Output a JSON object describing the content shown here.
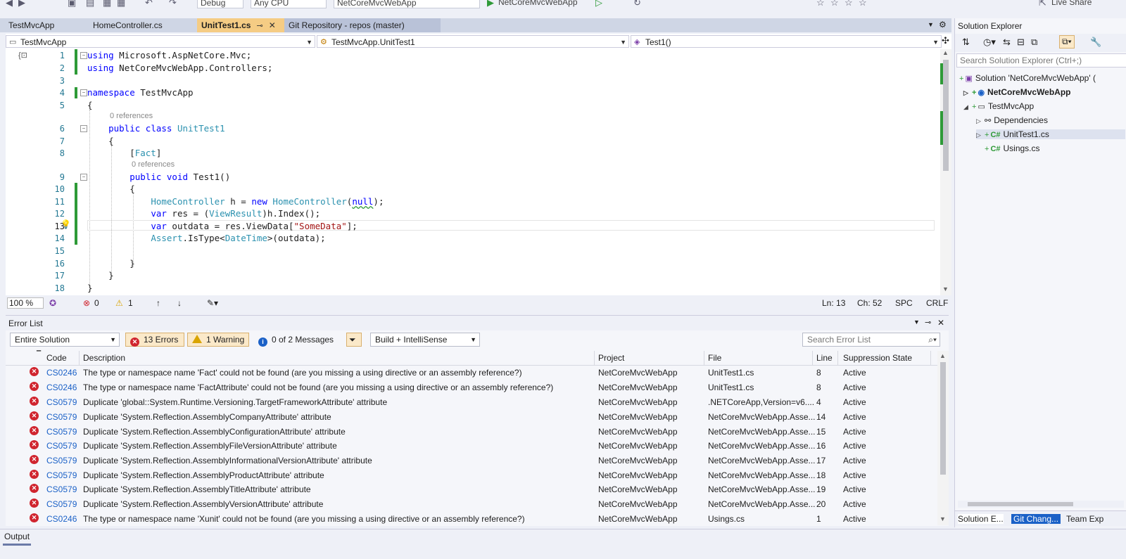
{
  "toolbar": {
    "config": "Debug",
    "platform": "Any CPU",
    "startup": "NetCoreMvcWebApp",
    "run_label": "NetCoreMvcWebApp",
    "live_share": "Live Share"
  },
  "tabs": [
    {
      "label": "TestMvcApp"
    },
    {
      "label": "HomeController.cs"
    },
    {
      "label": "UnitTest1.cs",
      "pin": "⊸",
      "close": "✕"
    },
    {
      "label": "Git Repository - repos (master)"
    }
  ],
  "nav": {
    "project": "TestMvcApp",
    "type": "TestMvcApp.UnitTest1",
    "member": "Test1()"
  },
  "code": {
    "lines": [
      "1",
      "2",
      "3",
      "4",
      "5",
      "6",
      "7",
      "8",
      "9",
      "10",
      "11",
      "12",
      "13",
      "14",
      "15",
      "16",
      "17",
      "18"
    ],
    "codelens_class": "0 references",
    "codelens_method": "0 references"
  },
  "editor_status": {
    "zoom": "100 %",
    "errors": "0",
    "warnings": "1",
    "ln": "Ln: 13",
    "ch": "Ch: 52",
    "spc": "SPC",
    "crlf": "CRLF"
  },
  "error_list": {
    "title": "Error List",
    "scope": "Entire Solution",
    "errors_btn": "13 Errors",
    "warnings_btn": "1 Warning",
    "messages_btn": "0 of 2 Messages",
    "source": "Build + IntelliSense",
    "search_placeholder": "Search Error List",
    "columns": {
      "code": "Code",
      "description": "Description",
      "project": "Project",
      "file": "File",
      "line": "Line",
      "suppression": "Suppression State"
    },
    "rows": [
      {
        "code": "CS0246",
        "desc": "The type or namespace name 'Fact' could not be found (are you missing a using directive or an assembly reference?)",
        "project": "NetCoreMvcWebApp",
        "file": "UnitTest1.cs",
        "line": "8",
        "state": "Active"
      },
      {
        "code": "CS0246",
        "desc": "The type or namespace name 'FactAttribute' could not be found (are you missing a using directive or an assembly reference?)",
        "project": "NetCoreMvcWebApp",
        "file": "UnitTest1.cs",
        "line": "8",
        "state": "Active"
      },
      {
        "code": "CS0579",
        "desc": "Duplicate 'global::System.Runtime.Versioning.TargetFrameworkAttribute' attribute",
        "project": "NetCoreMvcWebApp",
        "file": ".NETCoreApp,Version=v6....",
        "line": "4",
        "state": "Active"
      },
      {
        "code": "CS0579",
        "desc": "Duplicate 'System.Reflection.AssemblyCompanyAttribute' attribute",
        "project": "NetCoreMvcWebApp",
        "file": "NetCoreMvcWebApp.Asse...",
        "line": "14",
        "state": "Active"
      },
      {
        "code": "CS0579",
        "desc": "Duplicate 'System.Reflection.AssemblyConfigurationAttribute' attribute",
        "project": "NetCoreMvcWebApp",
        "file": "NetCoreMvcWebApp.Asse...",
        "line": "15",
        "state": "Active"
      },
      {
        "code": "CS0579",
        "desc": "Duplicate 'System.Reflection.AssemblyFileVersionAttribute' attribute",
        "project": "NetCoreMvcWebApp",
        "file": "NetCoreMvcWebApp.Asse...",
        "line": "16",
        "state": "Active"
      },
      {
        "code": "CS0579",
        "desc": "Duplicate 'System.Reflection.AssemblyInformationalVersionAttribute' attribute",
        "project": "NetCoreMvcWebApp",
        "file": "NetCoreMvcWebApp.Asse...",
        "line": "17",
        "state": "Active"
      },
      {
        "code": "CS0579",
        "desc": "Duplicate 'System.Reflection.AssemblyProductAttribute' attribute",
        "project": "NetCoreMvcWebApp",
        "file": "NetCoreMvcWebApp.Asse...",
        "line": "18",
        "state": "Active"
      },
      {
        "code": "CS0579",
        "desc": "Duplicate 'System.Reflection.AssemblyTitleAttribute' attribute",
        "project": "NetCoreMvcWebApp",
        "file": "NetCoreMvcWebApp.Asse...",
        "line": "19",
        "state": "Active"
      },
      {
        "code": "CS0579",
        "desc": "Duplicate 'System.Reflection.AssemblyVersionAttribute' attribute",
        "project": "NetCoreMvcWebApp",
        "file": "NetCoreMvcWebApp.Asse...",
        "line": "20",
        "state": "Active"
      },
      {
        "code": "CS0246",
        "desc": "The type or namespace name 'Xunit' could not be found (are you missing a using directive or an assembly reference?)",
        "project": "NetCoreMvcWebApp",
        "file": "Usings.cs",
        "line": "1",
        "state": "Active"
      }
    ]
  },
  "output": {
    "title": "Output"
  },
  "solution_explorer": {
    "title": "Solution Explorer",
    "search_placeholder": "Search Solution Explorer (Ctrl+;)",
    "items": [
      {
        "label": "Solution 'NetCoreMvcWebApp' ("
      },
      {
        "label": "NetCoreMvcWebApp"
      },
      {
        "label": "TestMvcApp"
      },
      {
        "label": "Dependencies"
      },
      {
        "label": "UnitTest1.cs"
      },
      {
        "label": "Usings.cs"
      }
    ],
    "csharp_badge": "C#",
    "bottom_tabs": [
      "Solution E...",
      "Git Chang...",
      "Team Exp"
    ]
  }
}
